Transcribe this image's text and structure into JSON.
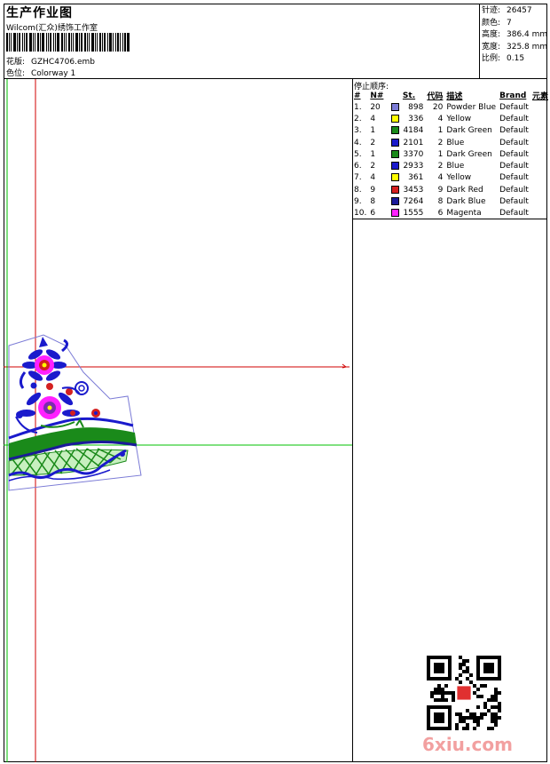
{
  "header": {
    "title": "生产作业图",
    "company": "Wilcom(汇众)绣饰工作室",
    "design_label": "花版:",
    "design_value": "GZHC4706.emb",
    "colorway_label": "色位:",
    "colorway_value": "Colorway 1"
  },
  "stats": [
    {
      "label": "针迹:",
      "value": "26457"
    },
    {
      "label": "颜色:",
      "value": "7"
    },
    {
      "label": "高度:",
      "value": "386.4 mm"
    },
    {
      "label": "宽度:",
      "value": "325.8 mm"
    },
    {
      "label": "比例:",
      "value": "0.15"
    }
  ],
  "stop_sequence": {
    "title": "停止顺序:",
    "headers": [
      "#",
      "N#",
      "St.",
      "代码",
      "描述",
      "Brand",
      "元素"
    ],
    "rows": [
      {
        "idx": "1.",
        "n": "20",
        "color": "#7b7bd6",
        "st": "898",
        "code": "20",
        "desc": "Powder Blue",
        "brand": "Default"
      },
      {
        "idx": "2.",
        "n": "4",
        "color": "#ffff00",
        "st": "336",
        "code": "4",
        "desc": "Yellow",
        "brand": "Default"
      },
      {
        "idx": "3.",
        "n": "1",
        "color": "#1a8a1a",
        "st": "4184",
        "code": "1",
        "desc": "Dark Green",
        "brand": "Default"
      },
      {
        "idx": "4.",
        "n": "2",
        "color": "#1a1acc",
        "st": "2101",
        "code": "2",
        "desc": "Blue",
        "brand": "Default"
      },
      {
        "idx": "5.",
        "n": "1",
        "color": "#1a8a1a",
        "st": "3370",
        "code": "1",
        "desc": "Dark Green",
        "brand": "Default"
      },
      {
        "idx": "6.",
        "n": "2",
        "color": "#1a1acc",
        "st": "2933",
        "code": "2",
        "desc": "Blue",
        "brand": "Default"
      },
      {
        "idx": "7.",
        "n": "4",
        "color": "#ffff00",
        "st": "361",
        "code": "4",
        "desc": "Yellow",
        "brand": "Default"
      },
      {
        "idx": "8.",
        "n": "9",
        "color": "#d42020",
        "st": "3453",
        "code": "9",
        "desc": "Dark Red",
        "brand": "Default"
      },
      {
        "idx": "9.",
        "n": "8",
        "color": "#1a1a9a",
        "st": "7264",
        "code": "8",
        "desc": "Dark Blue",
        "brand": "Default"
      },
      {
        "idx": "10.",
        "n": "6",
        "color": "#ff20ff",
        "st": "1555",
        "code": "6",
        "desc": "Magenta",
        "brand": "Default"
      }
    ]
  },
  "watermark": "6xiu.com",
  "colors": {
    "crosshair_red": "#d00000",
    "crosshair_green": "#00c000",
    "outline": "#3a3aa0"
  }
}
